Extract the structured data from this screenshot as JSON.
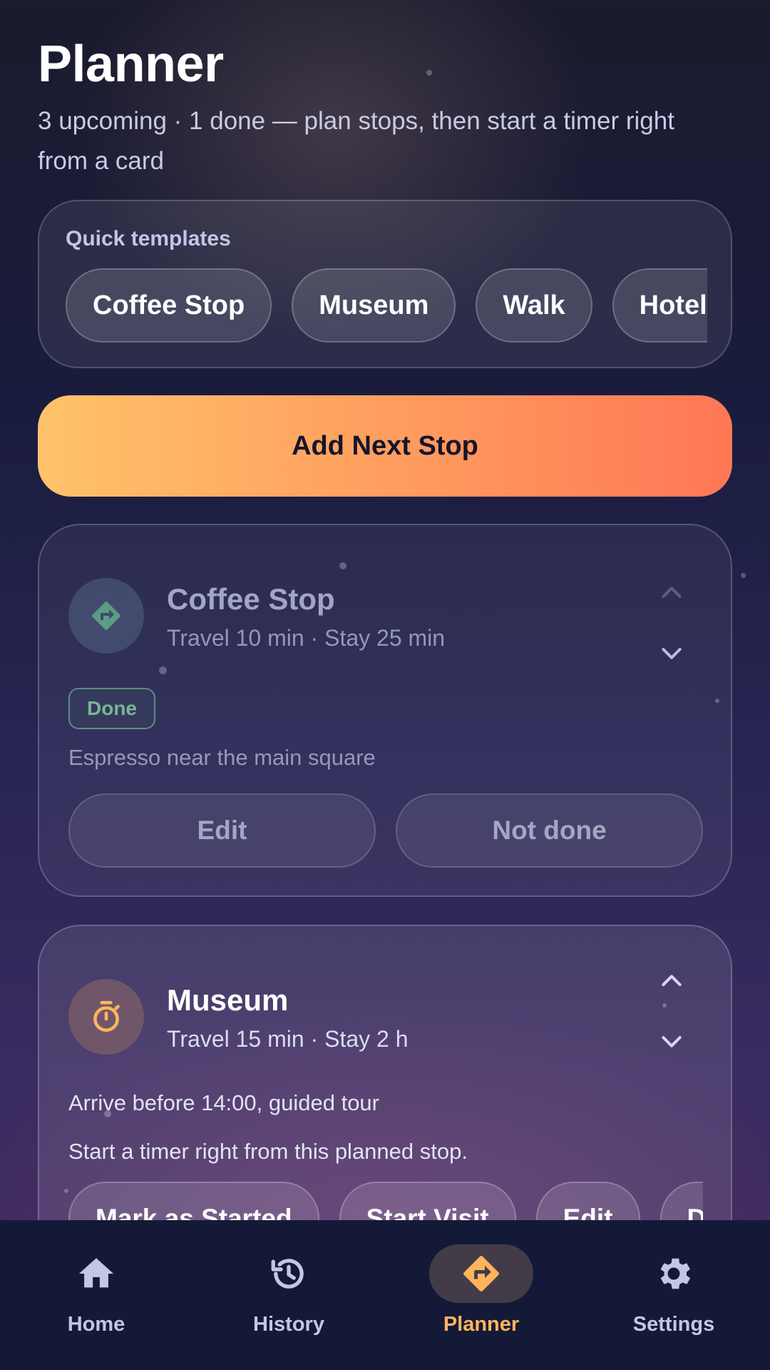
{
  "header": {
    "title": "Planner",
    "subtitle": "3 upcoming · 1 done — plan stops, then start a timer right from a card"
  },
  "templates": {
    "label": "Quick templates",
    "chips": [
      "Coffee Stop",
      "Museum",
      "Walk",
      "Hotel Return"
    ]
  },
  "add_button": {
    "label": "Add Next Stop"
  },
  "stops": [
    {
      "name": "Coffee Stop",
      "meta": "Travel 10 min · Stay 25 min",
      "status": "Done",
      "note": "Espresso near the main square",
      "icon": "directions-icon",
      "actions": [
        "Edit",
        "Not done"
      ]
    },
    {
      "name": "Museum",
      "meta": "Travel 15 min · Stay 2 h",
      "note": "Arrive before 14:00, guided tour",
      "hint": "Start a timer right from this planned stop.",
      "icon": "timer-icon",
      "actions": [
        "Mark as Started",
        "Start Visit",
        "Edit",
        "Done"
      ]
    }
  ],
  "nav": {
    "items": [
      {
        "label": "Home",
        "icon": "home-icon"
      },
      {
        "label": "History",
        "icon": "history-icon"
      },
      {
        "label": "Planner",
        "icon": "directions-icon",
        "selected": true
      },
      {
        "label": "Settings",
        "icon": "gear-icon"
      }
    ]
  },
  "colors": {
    "accent": "#ffb45e",
    "gradient_start": "#ffc36a",
    "gradient_end": "#ff7756",
    "done_green": "#79b596",
    "nav_background": "#141938"
  }
}
